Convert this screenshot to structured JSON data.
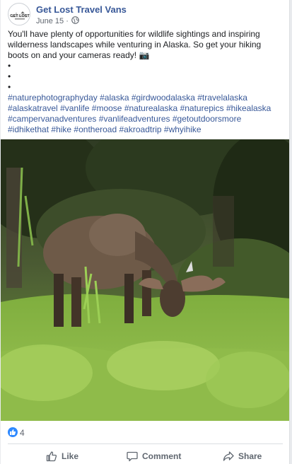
{
  "post": {
    "page_name": "Get Lost Travel Vans",
    "date": "June 15 ·",
    "avatar_logo_text": "GET LOST",
    "body": "You'll have plenty of opportunities for wildlife sightings and inspiring wilderness landscapes while venturing in Alaska. So get your hiking boots on and your cameras ready! 📷",
    "bullets": [
      "•",
      "•",
      "•"
    ],
    "hashtags": [
      "#naturephotographyday",
      "#alaska",
      "#girdwoodalaska",
      "#travelalaska",
      "#alaskatravel",
      "#vanlife",
      "#moose",
      "#naturealaska",
      "#naturepics",
      "#hikealaska",
      "#campervanadventures",
      "#vanlifeadventures",
      "#getoutdoorsmore",
      "#idhikethat",
      "#hike",
      "#ontheroad",
      "#akroadtrip",
      "#whyihike"
    ]
  },
  "reactions": {
    "count": "4",
    "icon": "thumbs-up-icon"
  },
  "actions": {
    "like_label": "Like",
    "comment_label": "Comment",
    "share_label": "Share"
  },
  "colors": {
    "link": "#385898",
    "text": "#1c1e21",
    "muted": "#616770",
    "like_blue": "#2e89ff"
  }
}
